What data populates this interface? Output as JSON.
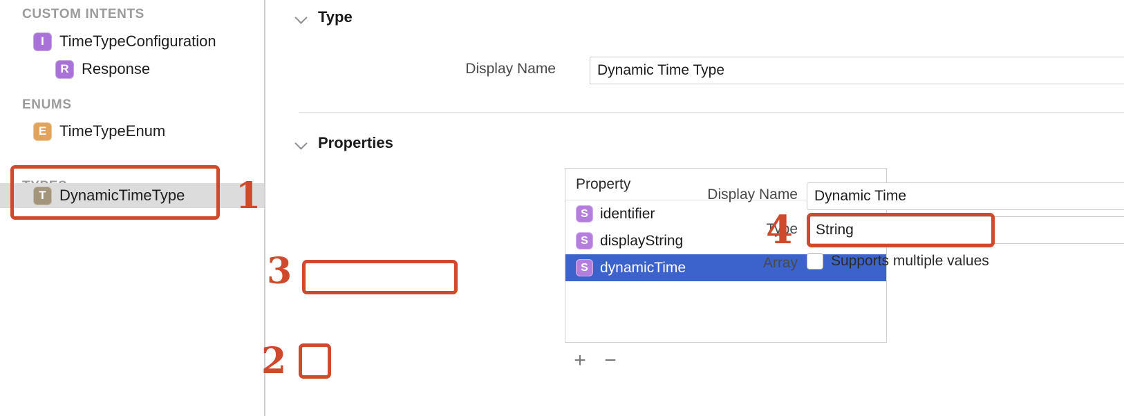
{
  "sidebar": {
    "groups": [
      {
        "header": "CUSTOM INTENTS",
        "items": [
          {
            "badge": "I",
            "label": "TimeTypeConfiguration",
            "kind": "intent",
            "indent": 0
          },
          {
            "badge": "R",
            "label": "Response",
            "kind": "response",
            "indent": 1
          }
        ]
      },
      {
        "header": "ENUMS",
        "items": [
          {
            "badge": "E",
            "label": "TimeTypeEnum",
            "kind": "enum",
            "indent": 0
          }
        ]
      },
      {
        "header": "TYPES",
        "items": [
          {
            "badge": "T",
            "label": "DynamicTimeType",
            "kind": "type",
            "indent": 0,
            "selected": true
          }
        ]
      }
    ]
  },
  "detail": {
    "type_section": {
      "title": "Type",
      "display_name_label": "Display Name",
      "display_name_value": "Dynamic Time Type"
    },
    "properties_section": {
      "title": "Properties",
      "table": {
        "column_header": "Property",
        "rows": [
          {
            "badge": "S",
            "name": "identifier",
            "selected": false
          },
          {
            "badge": "S",
            "name": "displayString",
            "selected": false
          },
          {
            "badge": "S",
            "name": "dynamicTime",
            "selected": true
          }
        ]
      },
      "footer": {
        "add_label": "+",
        "remove_label": "−"
      },
      "inspector": {
        "display_name_label": "Display Name",
        "display_name_value": "Dynamic Time",
        "type_label": "Type",
        "type_value": "String",
        "array_label": "Array",
        "array_checkbox_label": "Supports multiple values",
        "array_checked": false
      }
    }
  },
  "annotations": {
    "accent_color": "#cf4a2c",
    "numbers": [
      "1",
      "2",
      "3",
      "4"
    ],
    "boxes": [
      "types-group-box",
      "add-property-button-box",
      "dynamic-time-row-box",
      "type-popup-box"
    ]
  },
  "colors": {
    "selection_blue": "#3c63cb",
    "sidebar_selection_gray": "#dcdcdc",
    "intent_badge": "#a972d8",
    "enum_badge": "#e2a45c",
    "type_badge": "#a3957b",
    "string_badge": "#b47fdc"
  }
}
